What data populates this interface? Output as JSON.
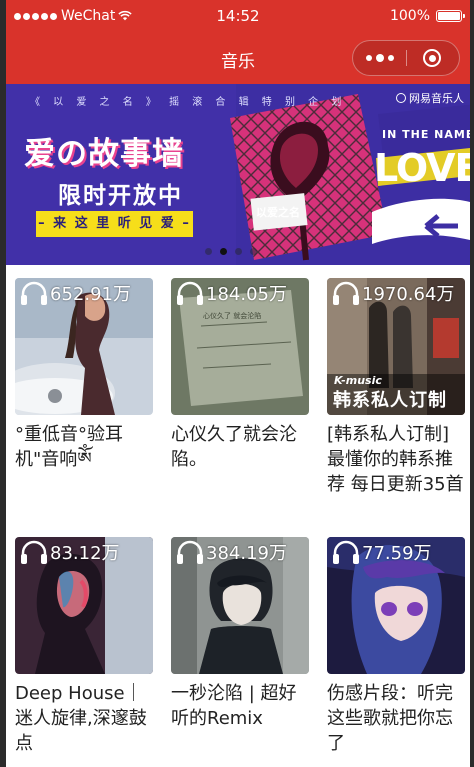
{
  "status_bar": {
    "carrier": "WeChat",
    "time": "14:52",
    "battery": "100%"
  },
  "nav": {
    "title": "音乐"
  },
  "banner": {
    "top_text": "《 以 爱 之 名 》 摇 滚 合 辑 特 别 企 划",
    "brand": "网易音乐人",
    "headline": "爱の故事墙",
    "subheadline": "限时开放中",
    "cta": "– 来 这 里 听 见 爱 –",
    "in_the_name": "IN THE NAME OF",
    "love": "LOVE",
    "album_tag": "以爱之名",
    "page_count": 4,
    "active_page": 1
  },
  "playlists": [
    {
      "plays": "652.91万",
      "title": "°重低音°验耳机\"音响ༀ"
    },
    {
      "plays": "184.05万",
      "title": "心仪久了就会沦陷。"
    },
    {
      "plays": "1970.64万",
      "title": "[韩系私人订制]最懂你的韩系推荐 每日更新35首",
      "caption_small": "K-music",
      "caption_big": "韩系私人订制"
    },
    {
      "plays": "83.12万",
      "title": "Deep House｜迷人旋律,深邃鼓点"
    },
    {
      "plays": "384.19万",
      "title": "一秒沦陷 | 超好听的Remix"
    },
    {
      "plays": "77.59万",
      "title": "伤感片段：听完这些歌就把你忘了"
    }
  ],
  "colors": {
    "brand_red": "#d9332b",
    "banner_purple": "#3f2fa6",
    "cta_yellow": "#f6de1a"
  },
  "icons": [
    "wifi-icon",
    "battery-icon",
    "more-icon",
    "close-mini-program-icon",
    "headphone-icon"
  ]
}
